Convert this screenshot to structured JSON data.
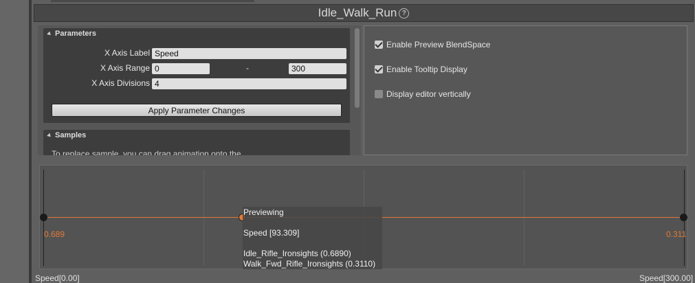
{
  "window": {
    "title": "Idle_Walk_Run"
  },
  "parameters": {
    "header": "Parameters",
    "x_axis_label": {
      "label": "X Axis Label",
      "value": "Speed"
    },
    "x_axis_range": {
      "label": "X Axis Range",
      "min": "0",
      "separator": "-",
      "max": "300"
    },
    "x_axis_divisions": {
      "label": "X Axis Divisions",
      "value": "4"
    },
    "apply_button": "Apply Parameter Changes"
  },
  "samples": {
    "header": "Samples",
    "instructions": "To replace sample, you can drag animation onto the"
  },
  "options": {
    "enable_preview": {
      "label": "Enable Preview BlendSpace",
      "checked": true
    },
    "enable_tooltip": {
      "label": "Enable Tooltip Display",
      "checked": true
    },
    "display_vertical": {
      "label": "Display editor vertically",
      "checked": false
    }
  },
  "graph": {
    "left_weight": "0.689",
    "right_weight": "0.311",
    "axis_min_label": "Speed[0.00]",
    "axis_max_label": "Speed[300.00]",
    "preview_position": 93.309,
    "tooltip": {
      "title": "Previewing",
      "speed": "Speed [93.309]",
      "sample1": "Idle_Rifle_Ironsights (0.6890)",
      "sample2": "Walk_Fwd_Rifle_Ironsights (0.3110)"
    },
    "accent_color": "#e07a38"
  },
  "icons": [
    "help-icon",
    "collapse-triangle-icon",
    "checkbox-icon"
  ]
}
